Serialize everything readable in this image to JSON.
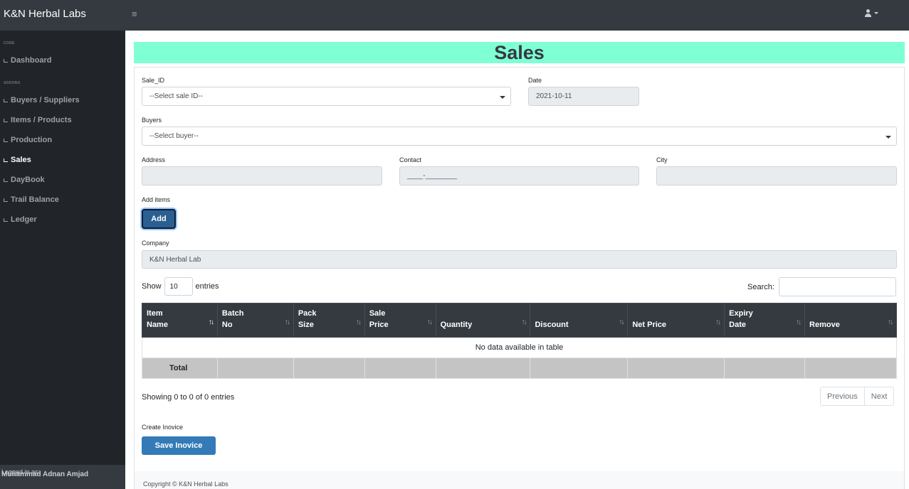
{
  "header": {
    "brand": "K&N Herbal Labs",
    "menu_icon": "≡",
    "user_icon": "user-icon"
  },
  "sidebar": {
    "sections": [
      {
        "heading": "CORE",
        "items": [
          {
            "label": "Dashboard",
            "icon": "dashboard-icon"
          }
        ]
      },
      {
        "heading": "ADDONS",
        "items": [
          {
            "label": "Buyers / Suppliers",
            "icon": "chart-icon"
          },
          {
            "label": "Items / Products",
            "icon": "chart-icon"
          },
          {
            "label": "Production",
            "icon": "chart-icon"
          },
          {
            "label": "Sales",
            "icon": "chart-icon",
            "active": true
          },
          {
            "label": "DayBook",
            "icon": "chart-icon"
          },
          {
            "label": "Trail Balance",
            "icon": "table-icon"
          },
          {
            "label": "Ledger",
            "icon": "table-icon"
          }
        ]
      }
    ],
    "footer": {
      "logged_in_label": "Logged in as:",
      "user_name": "Muhammad Adnan Amjad"
    }
  },
  "page": {
    "title": "Sales"
  },
  "form": {
    "sale_id": {
      "label": "Sale_ID",
      "value": "--Select sale ID--"
    },
    "date": {
      "label": "Date",
      "value": "2021-10-11"
    },
    "buyers": {
      "label": "Buyers",
      "value": "--Select buyer--"
    },
    "address": {
      "label": "Address",
      "value": ""
    },
    "contact": {
      "label": "Contact",
      "value": "____-________"
    },
    "city": {
      "label": "City",
      "value": ""
    },
    "add_items": {
      "label": "Add items",
      "button": "Add"
    },
    "company": {
      "label": "Company",
      "value": "K&N Herbal Lab"
    }
  },
  "table": {
    "show_label": "Show",
    "page_length": "10",
    "entries_label": "entries",
    "search_label": "Search:",
    "columns": [
      [
        "Item",
        "Name"
      ],
      [
        "Batch",
        "No"
      ],
      [
        "Pack",
        "Size"
      ],
      [
        "Sale",
        "Price"
      ],
      [
        "",
        "Quantity"
      ],
      [
        "",
        "Discount"
      ],
      [
        "",
        "Net Price"
      ],
      [
        "Expiry",
        "Date"
      ],
      [
        "",
        "Remove"
      ]
    ],
    "empty_message": "No data available in table",
    "total_label": "Total",
    "info": "Showing 0 to 0 of 0 entries",
    "prev": "Previous",
    "next": "Next"
  },
  "invoice": {
    "label": "Create Inovice",
    "button": "Save Inovice"
  },
  "footer": {
    "copyright": "Copyright © K&N Herbal Labs"
  },
  "colors": {
    "title_bg": "#7fffd4",
    "nav_bg": "#343a40",
    "sidebar_bg": "#212529",
    "primary": "#337ab7"
  }
}
